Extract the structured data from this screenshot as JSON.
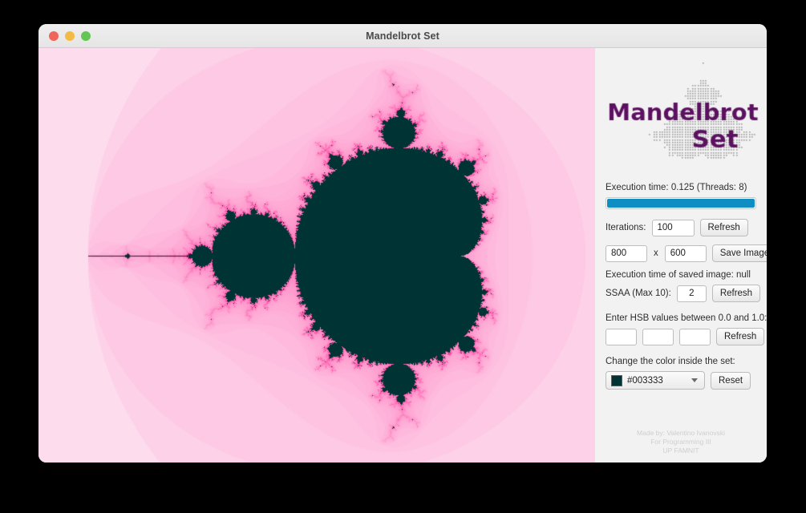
{
  "window": {
    "title": "Mandelbrot Set",
    "traffic_lights": [
      "close-button",
      "minimize-button",
      "zoom-button"
    ]
  },
  "logo": {
    "line1": "Mandelbrot",
    "line2": "Set",
    "text_color": "#5c1060",
    "dot_color": "#9a9a9a"
  },
  "sidebar": {
    "execution_time_label": "Execution time: 0.125  (Threads: 8)",
    "progress": {
      "value": 100,
      "color": "#0f8ec4"
    },
    "iterations_label": "Iterations:",
    "iterations_value": "100",
    "iterations_refresh_label": "Refresh",
    "width_value": "800",
    "x_separator": "x",
    "height_value": "600",
    "save_image_label": "Save Image",
    "saved_time_label": "Execution time of saved image: null",
    "ssaa_label": "SSAA (Max 10):",
    "ssaa_value": "2",
    "ssaa_refresh_label": "Refresh",
    "hsb_label": "Enter HSB values between 0.0 and 1.0:",
    "hsb_hue": "",
    "hsb_sat": "",
    "hsb_bri": "",
    "hsb_placeholder": "",
    "hsb_refresh_label": "Refresh",
    "color_label": "Change the color inside the set:",
    "color_value": "#003333",
    "color_swatch": "#003333",
    "reset_label": "Reset"
  },
  "credits": {
    "line1": "Made by: Valentino Ivanovski",
    "line2": "For Programming III",
    "line3": "UP FAMNIT"
  },
  "fractal": {
    "interior_color": "#003333",
    "edge_color": "#ff3fa0",
    "background_color": "#fdfbfd",
    "center_x": -0.62,
    "center_y": 0.0,
    "scale": 3.35,
    "max_iterations": 100
  }
}
